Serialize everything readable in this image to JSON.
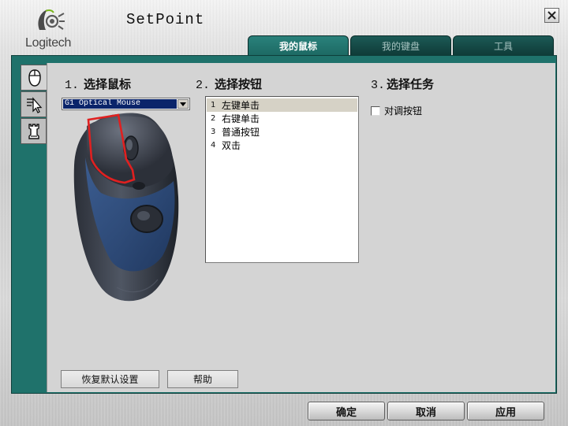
{
  "app": {
    "logo_text": "Logitech",
    "title": "SetPoint"
  },
  "tabs": [
    {
      "label": "我的鼠标",
      "active": true
    },
    {
      "label": "我的键盘",
      "active": false
    },
    {
      "label": "工具",
      "active": false
    }
  ],
  "side_tabs": [
    {
      "icon": "mouse-icon",
      "active": true
    },
    {
      "icon": "pointer-icon",
      "active": false
    },
    {
      "icon": "game-piece-icon",
      "active": false
    }
  ],
  "step1": {
    "number": "1.",
    "label": "选择鼠标"
  },
  "step2": {
    "number": "2.",
    "label": "选择按钮"
  },
  "step3": {
    "number": "3.",
    "label": "选择任务"
  },
  "mouse_select": {
    "value": "G1 Optical Mouse"
  },
  "buttons_list": [
    {
      "num": "1",
      "label": "左键单击",
      "selected": true
    },
    {
      "num": "2",
      "label": "右键单击",
      "selected": false
    },
    {
      "num": "3",
      "label": "普通按钮",
      "selected": false
    },
    {
      "num": "4",
      "label": "双击",
      "selected": false
    }
  ],
  "task_option": {
    "label": "对调按钮",
    "checked": false
  },
  "content_buttons": {
    "restore": "恢复默认设置",
    "help": "帮助"
  },
  "dialog_buttons": {
    "ok": "确定",
    "cancel": "取消",
    "apply": "应用"
  },
  "colors": {
    "frame": "#1f726b",
    "tab_active": "#2a817b",
    "tab_inactive": "#0f3b38",
    "highlight_outline": "#e02020",
    "selection": "#0a246a"
  }
}
